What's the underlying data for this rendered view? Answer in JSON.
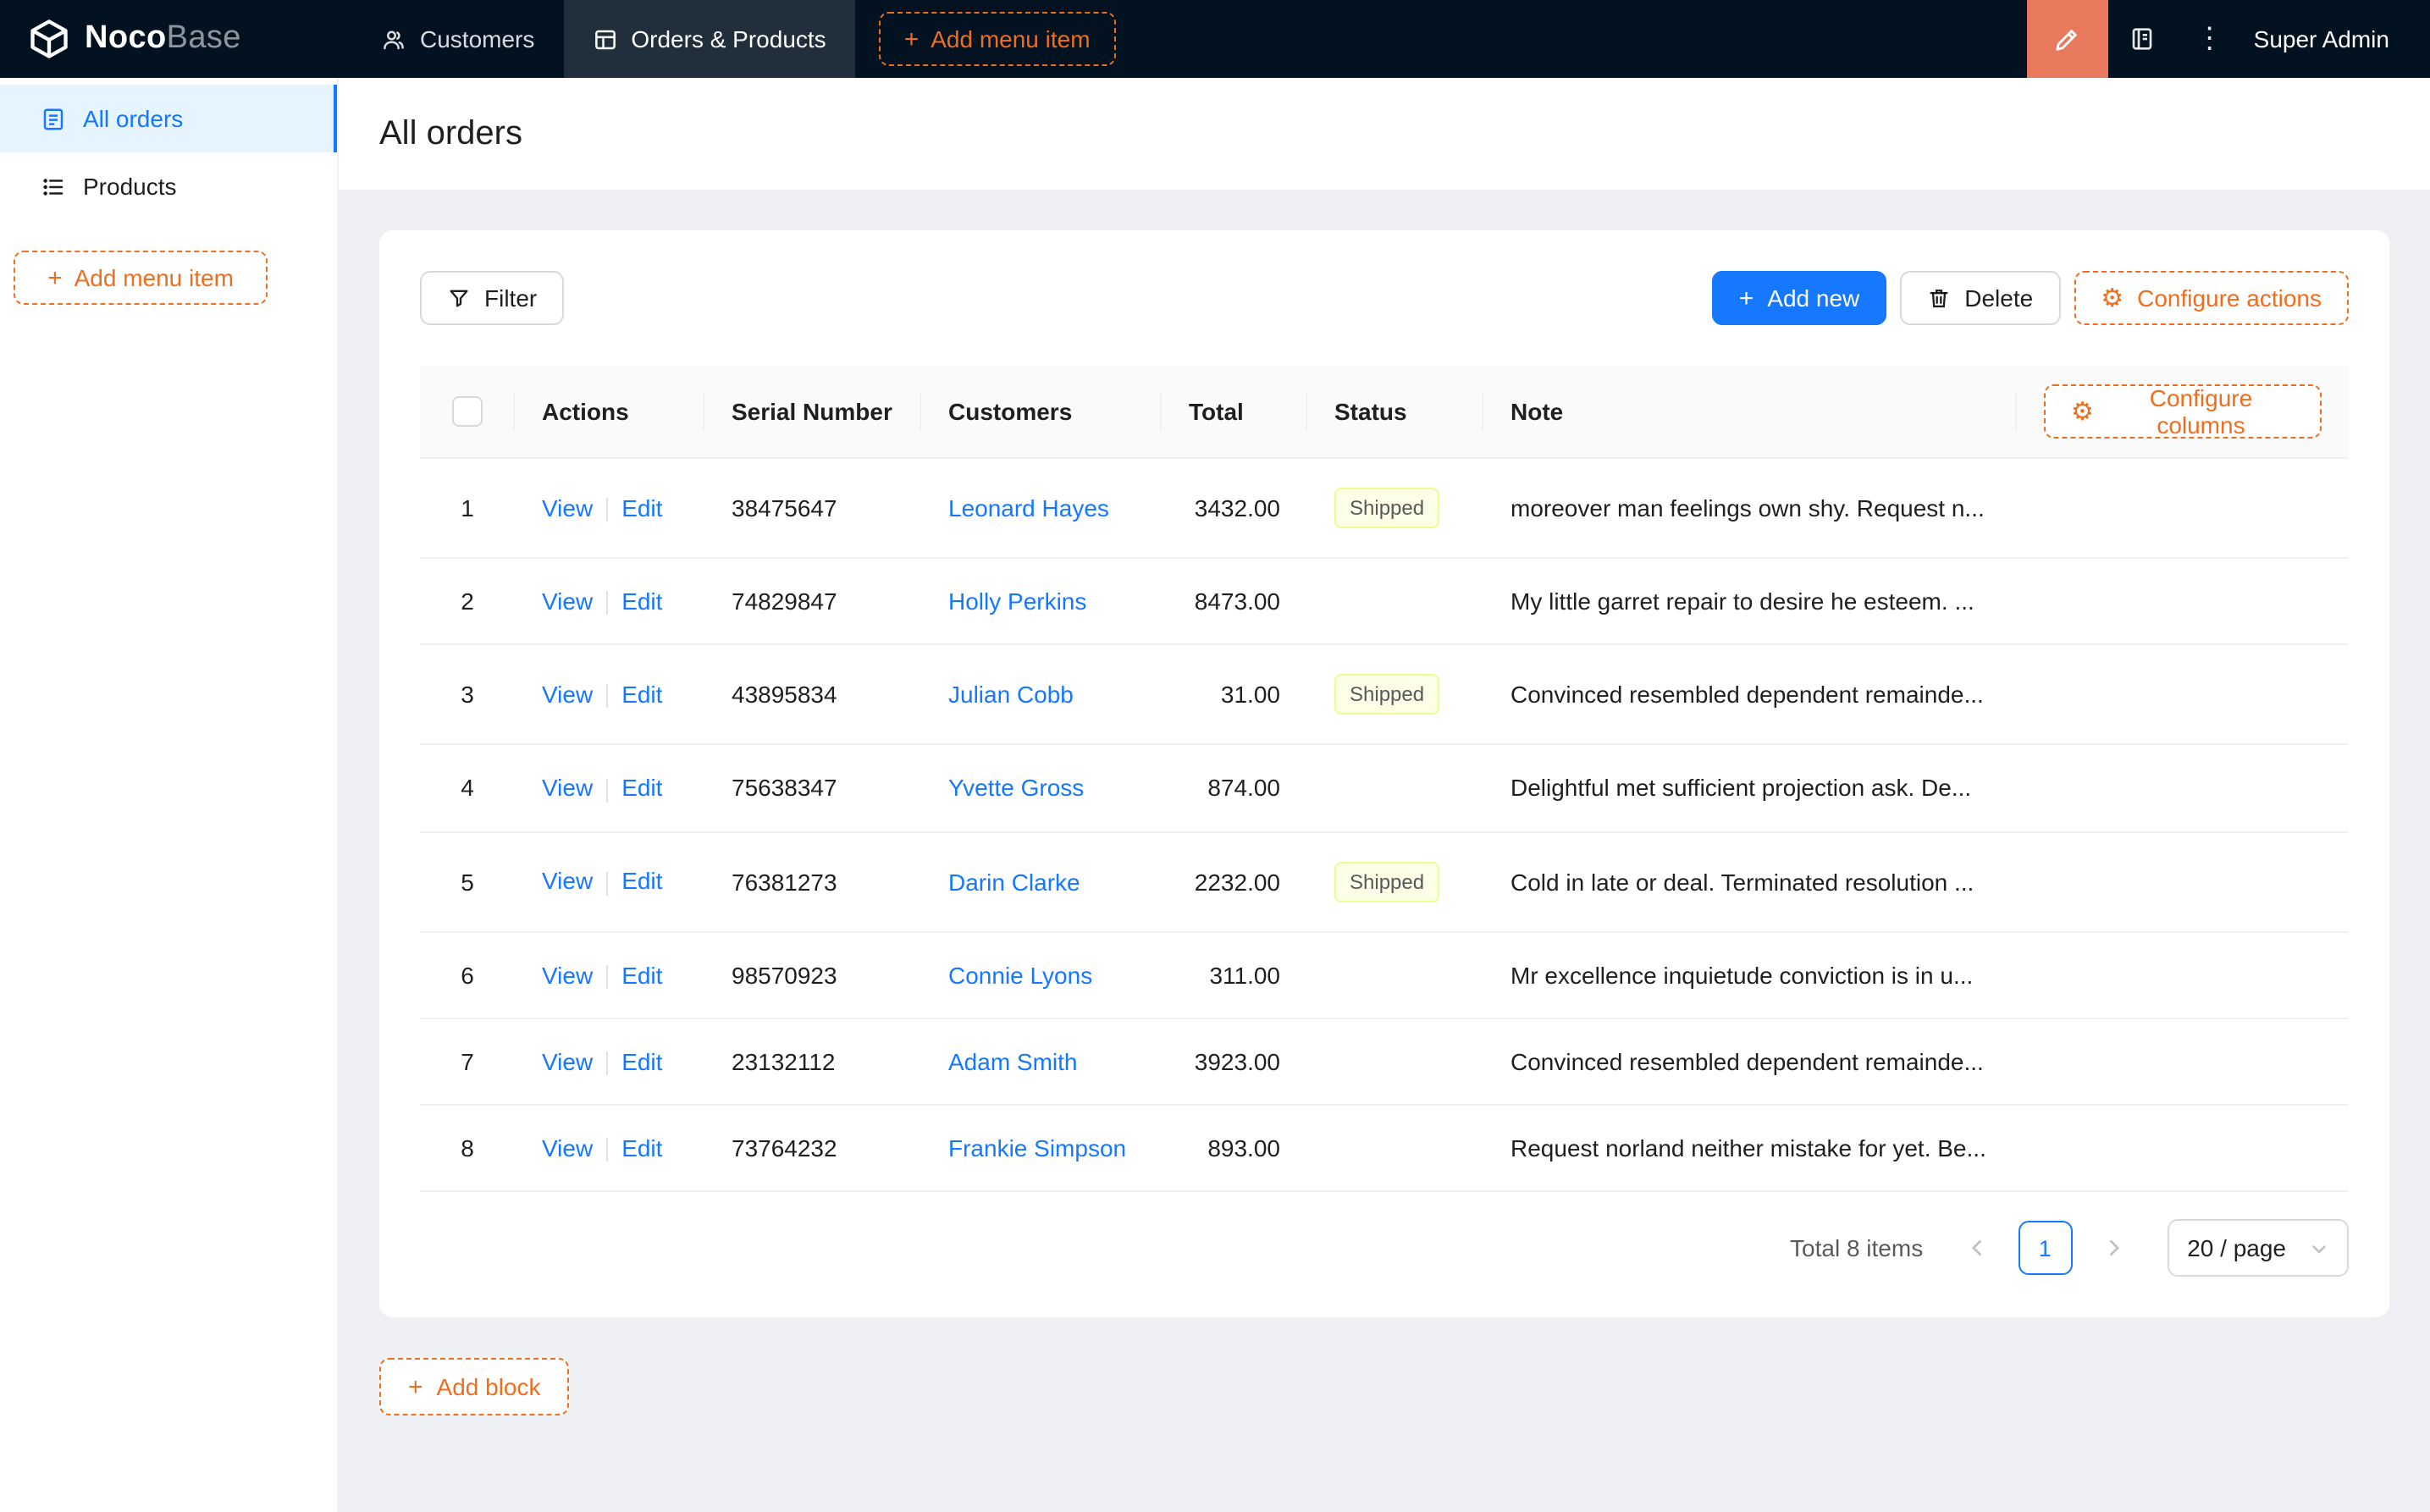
{
  "navbar": {
    "logo": {
      "bold": "Noco",
      "light": "Base"
    },
    "menu": [
      {
        "label": "Customers"
      },
      {
        "label": "Orders & Products",
        "active": true
      },
      {
        "label": "Add menu item",
        "type": "dashed-add"
      }
    ],
    "user": "Super Admin"
  },
  "sidebar": {
    "items": [
      {
        "label": "All orders",
        "active": true
      },
      {
        "label": "Products"
      }
    ],
    "add_button_label": "Add menu item"
  },
  "page": {
    "title": "All orders"
  },
  "toolbar": {
    "filter": "Filter",
    "add_new": "Add new",
    "delete": "Delete",
    "configure_actions": "Configure actions"
  },
  "table": {
    "configure_columns": "Configure columns",
    "columns": [
      "Actions",
      "Serial Number",
      "Customers",
      "Total",
      "Status",
      "Note"
    ],
    "links": {
      "view": "View",
      "edit": "Edit"
    },
    "rows": [
      {
        "index": 1,
        "serial": "38475647",
        "customer": "Leonard Hayes",
        "total": "3432.00",
        "status": "Shipped",
        "note": "moreover man feelings own shy. Request n..."
      },
      {
        "index": 2,
        "serial": "74829847",
        "customer": "Holly Perkins",
        "total": "8473.00",
        "status": "",
        "note": "My little garret repair to desire he esteem. ..."
      },
      {
        "index": 3,
        "serial": "43895834",
        "customer": "Julian Cobb",
        "total": "31.00",
        "status": "Shipped",
        "note": "Convinced resembled dependent remainde..."
      },
      {
        "index": 4,
        "serial": "75638347",
        "customer": "Yvette Gross",
        "total": "874.00",
        "status": "",
        "note": "Delightful met sufficient projection ask. De..."
      },
      {
        "index": 5,
        "serial": "76381273",
        "customer": "Darin Clarke",
        "total": "2232.00",
        "status": "Shipped",
        "note": "Cold in late or deal. Terminated resolution ..."
      },
      {
        "index": 6,
        "serial": "98570923",
        "customer": "Connie Lyons",
        "total": "311.00",
        "status": "",
        "note": "Mr excellence inquietude conviction is in u..."
      },
      {
        "index": 7,
        "serial": "23132112",
        "customer": "Adam Smith",
        "total": "3923.00",
        "status": "",
        "note": "Convinced resembled dependent remainde..."
      },
      {
        "index": 8,
        "serial": "73764232",
        "customer": "Frankie Simpson",
        "total": "893.00",
        "status": "",
        "note": "Request norland neither mistake for yet. Be..."
      }
    ]
  },
  "pagination": {
    "total_text": "Total 8 items",
    "current_page": "1",
    "page_size": "20 / page"
  },
  "footer": {
    "add_block": "Add block"
  },
  "colors": {
    "primary": "#1677ff",
    "accent_orange": "#ee6e20",
    "editor_button": "#e8795c",
    "navbar_background": "#031221",
    "sidebar_active_background": "#e6f4ff",
    "status_tag_background": "#fcffe6",
    "status_tag_border": "#eaff8f",
    "content_background": "#eef0f3"
  }
}
